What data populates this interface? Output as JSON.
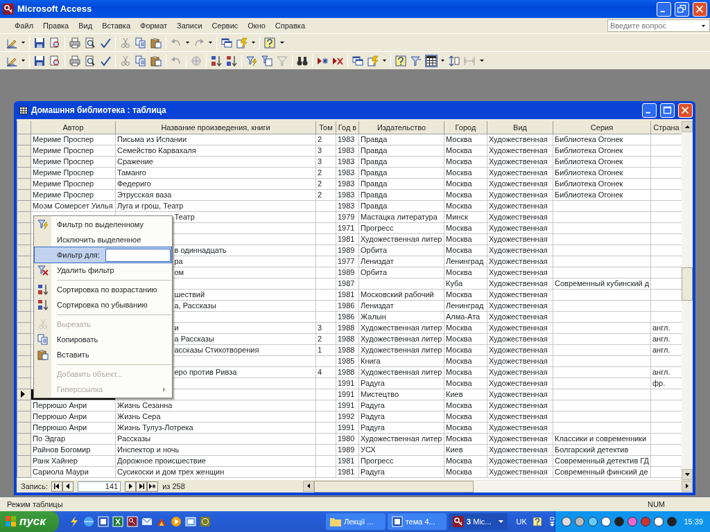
{
  "app": {
    "title": "Microsoft Access"
  },
  "menu": [
    "Файл",
    "Правка",
    "Вид",
    "Вставка",
    "Формат",
    "Записи",
    "Сервис",
    "Окно",
    "Справка"
  ],
  "help_search": {
    "placeholder": "Введите вопрос"
  },
  "datasheet": {
    "title": "Домашння библиотека : таблица",
    "columns": [
      "Автор",
      "Название произведения, книги",
      "Том",
      "Год в",
      "Издательство",
      "Город",
      "Вид",
      "Серия",
      "Страна"
    ],
    "rows": [
      {
        "selected": false,
        "cells": [
          "Мериме Проспер",
          "Письма из Испании",
          "2",
          "1983",
          "Правда",
          "Москва",
          "Художественная",
          "Библиотека Огонек",
          ""
        ]
      },
      {
        "selected": false,
        "cells": [
          "Мериме Проспер",
          "Семейство Карвахаля",
          "3",
          "1983",
          "Правда",
          "Москва",
          "Художественная",
          "Библиотека Огонек",
          ""
        ]
      },
      {
        "selected": false,
        "cells": [
          "Мериме Проспер",
          "Сражение",
          "3",
          "1983",
          "Правда",
          "Москва",
          "Художественная",
          "Библиотека Огонек",
          ""
        ]
      },
      {
        "selected": false,
        "cells": [
          "Мериме Проспер",
          "Таманго",
          "2",
          "1983",
          "Правда",
          "Москва",
          "Художественная",
          "Библиотека Огонек",
          ""
        ]
      },
      {
        "selected": false,
        "cells": [
          "Мериме Проспер",
          "Федериго",
          "2",
          "1983",
          "Правда",
          "Москва",
          "Художественная",
          "Библиотека Огонек",
          ""
        ]
      },
      {
        "selected": false,
        "cells": [
          "Мериме Проспер",
          "Этрусская ваза",
          "2",
          "1983",
          "Правда",
          "Москва",
          "Художественная",
          "Библиотека Огонек",
          ""
        ]
      },
      {
        "selected": false,
        "cells": [
          "Моэм Сомерсет Уилья",
          "Луга и грош, Театр",
          "",
          "1983",
          "Правда",
          "Москва",
          "Художественная",
          "",
          ""
        ]
      },
      {
        "selected": false,
        "cells": [
          "",
          "Театр",
          "",
          "1979",
          "Мастацка литература",
          "Минск",
          "Художественная",
          "",
          ""
        ]
      },
      {
        "selected": false,
        "cells": [
          "",
          "",
          "",
          "1971",
          "Прогресс",
          "Москва",
          "Художественная",
          "",
          ""
        ]
      },
      {
        "selected": false,
        "cells": [
          "",
          "",
          "",
          "1981",
          "Художественная литер",
          "Москва",
          "Художественная",
          "",
          ""
        ]
      },
      {
        "selected": false,
        "cells": [
          "",
          "в одиннадцать",
          "",
          "1989",
          "Орбита",
          "Москва",
          "Художественная",
          "",
          ""
        ]
      },
      {
        "selected": false,
        "cells": [
          "",
          "ра",
          "",
          "1977",
          "Лениздат",
          "Ленинград",
          "Художественная",
          "",
          ""
        ]
      },
      {
        "selected": false,
        "cells": [
          "",
          "ом",
          "",
          "1989",
          "Орбита",
          "Москва",
          "Художественная",
          "",
          ""
        ]
      },
      {
        "selected": false,
        "cells": [
          "",
          "",
          "",
          "1987",
          "",
          "Куба",
          "Художественная",
          "Современный кубинский д",
          ""
        ]
      },
      {
        "selected": false,
        "cells": [
          "",
          "шествий",
          "",
          "1981",
          "Московский рабочий",
          "Москва",
          "Художественная",
          "",
          ""
        ]
      },
      {
        "selected": false,
        "cells": [
          "",
          "а, Рассказы",
          "",
          "1986",
          "Лениздат",
          "Ленинград",
          "Художественная",
          "",
          ""
        ]
      },
      {
        "selected": false,
        "cells": [
          "",
          "",
          "",
          "1986",
          "Жалын",
          "Алма-Ата",
          "Художественная",
          "",
          ""
        ]
      },
      {
        "selected": false,
        "cells": [
          "",
          "и",
          "3",
          "1988",
          "Художественная литер",
          "Москва",
          "Художественная",
          "",
          "англ."
        ]
      },
      {
        "selected": false,
        "cells": [
          "",
          "а Рассказы",
          "2",
          "1988",
          "Художественная литер",
          "Москва",
          "Художественная",
          "",
          "англ."
        ]
      },
      {
        "selected": false,
        "cells": [
          "",
          "ассказы Стихотворения",
          "1",
          "1988",
          "Художественная литер",
          "Москва",
          "Художественная",
          "",
          "англ."
        ]
      },
      {
        "selected": false,
        "cells": [
          "",
          "",
          "",
          "1985",
          "Книга",
          "Москва",
          "Художественная",
          "",
          ""
        ]
      },
      {
        "selected": false,
        "cells": [
          "",
          "еро против Ривза",
          "4",
          "1988",
          "Художественная литер",
          "Москва",
          "Художественная",
          "",
          "англ."
        ]
      },
      {
        "selected": false,
        "cells": [
          "",
          "",
          "",
          "1991",
          "Радуга",
          "Москва",
          "Художественная",
          "",
          "фр."
        ]
      },
      {
        "selected": true,
        "cells": [
          "",
          "",
          "",
          "1991",
          "Мистецтво",
          "Киев",
          "Художественная",
          "",
          ""
        ]
      },
      {
        "selected": false,
        "cells": [
          "Перрюшо Анри",
          "Жизнь Сезанна",
          "",
          "1991",
          "Радуга",
          "Москва",
          "Художественная",
          "",
          ""
        ]
      },
      {
        "selected": false,
        "cells": [
          "Перрюшо Анри",
          "Жизнь Сера",
          "",
          "1992",
          "Радуга",
          "Москва",
          "Художественная",
          "",
          ""
        ]
      },
      {
        "selected": false,
        "cells": [
          "Перрюшо Анри",
          "Жизнь Тулуз-Лотрека",
          "",
          "1991",
          "Радуга",
          "Москва",
          "Художественная",
          "",
          ""
        ]
      },
      {
        "selected": false,
        "cells": [
          "По Эдгар",
          "Рассказы",
          "",
          "1980",
          "Художественная литер",
          "Москва",
          "Художественная",
          "Классики и современники",
          ""
        ]
      },
      {
        "selected": false,
        "cells": [
          "Райнов Богомир",
          "Инспектор и ночь",
          "",
          "1989",
          "УСХ",
          "Киев",
          "Художественная",
          "Болгарский детектив",
          ""
        ]
      },
      {
        "selected": false,
        "cells": [
          "Ранк Хайнер",
          "Дорожное происшествие",
          "",
          "1981",
          "Прогресс",
          "Москва",
          "Художественная",
          "Современный детектив ГД",
          ""
        ]
      },
      {
        "selected": false,
        "cells": [
          "Сариола  Маури",
          "Сусикоски и дом трех женщин",
          "",
          "1981",
          "Радуга",
          "Москва",
          "Художественная",
          "Современный финский де",
          ""
        ]
      }
    ]
  },
  "context_menu": {
    "items": [
      {
        "kind": "item",
        "label": "Фильтр по выделенному",
        "disabled": false,
        "selected": false
      },
      {
        "kind": "item",
        "label": "Исключить выделенное",
        "disabled": false,
        "selected": false
      },
      {
        "kind": "field",
        "label": "Фильтр для:",
        "disabled": false,
        "selected": true
      },
      {
        "kind": "item",
        "label": "Удалить фильтр",
        "disabled": false,
        "selected": false
      },
      {
        "kind": "separator"
      },
      {
        "kind": "item",
        "label": "Сортировка по возрастанию",
        "disabled": false,
        "selected": false
      },
      {
        "kind": "item",
        "label": "Сортировка по убыванию",
        "disabled": false,
        "selected": false
      },
      {
        "kind": "separator"
      },
      {
        "kind": "item",
        "label": "Вырезать",
        "disabled": true,
        "selected": false
      },
      {
        "kind": "item",
        "label": "Копировать",
        "disabled": false,
        "selected": false
      },
      {
        "kind": "item",
        "label": "Вставить",
        "disabled": false,
        "selected": false
      },
      {
        "kind": "separator"
      },
      {
        "kind": "item",
        "label": "Добавить объект...",
        "disabled": true,
        "selected": false
      },
      {
        "kind": "submenu",
        "label": "Гиперссылка",
        "disabled": true,
        "selected": false
      }
    ]
  },
  "navigator": {
    "label": "Запись:",
    "record": "141",
    "total": "из 258"
  },
  "status_bar": {
    "mode": "Режим таблицы",
    "indicator": "NUM"
  },
  "taskbar": {
    "start": "пуск",
    "tasks": [
      {
        "label": "Лекції ...",
        "selected": false
      },
      {
        "label": "тема 4...",
        "selected": false
      },
      {
        "label": "**3** Mic...",
        "selected": true
      }
    ],
    "language": "UK",
    "clock": "15:39"
  }
}
